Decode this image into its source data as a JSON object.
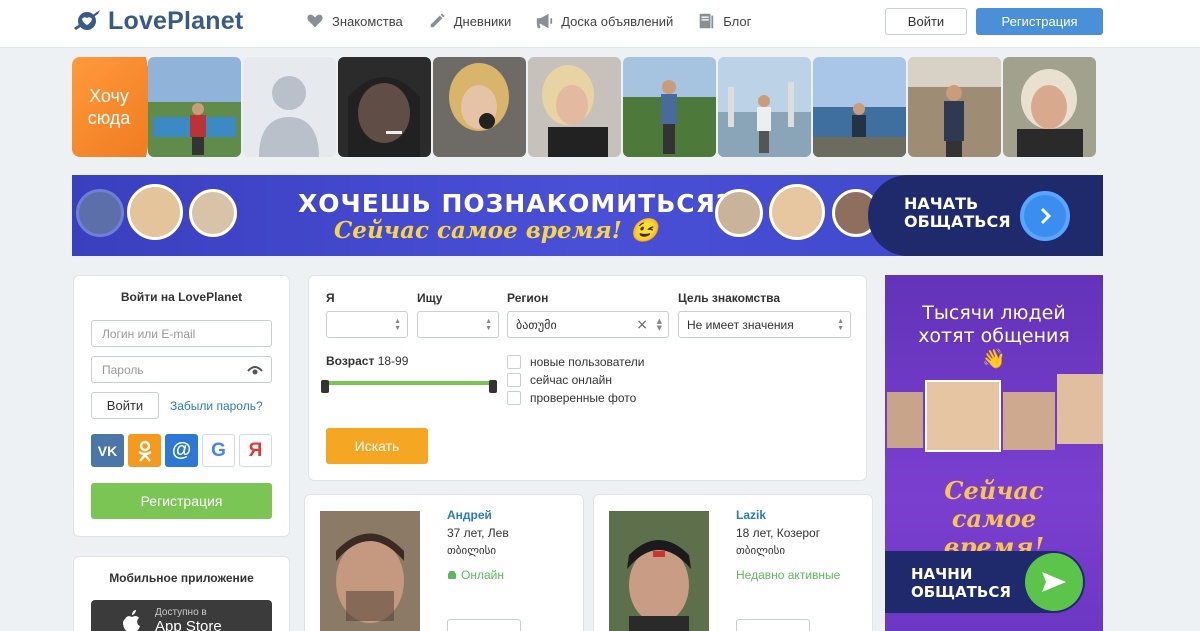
{
  "header": {
    "logo_text": "LovePlanet",
    "nav": [
      {
        "label": "Знакомства",
        "icon": "heart-icon"
      },
      {
        "label": "Дневники",
        "icon": "pencil-icon"
      },
      {
        "label": "Доска объявлений",
        "icon": "megaphone-icon"
      },
      {
        "label": "Блог",
        "icon": "book-icon"
      }
    ],
    "login_label": "Войти",
    "register_label": "Регистрация"
  },
  "strip": {
    "want_here": "Хочу сюда"
  },
  "banner": {
    "title": "ХОЧЕШЬ ПОЗНАКОМИТЬСЯ?",
    "subtitle": "Сейчас самое время! 😉",
    "cta": "НАЧАТЬ ОБЩАТЬСЯ"
  },
  "login": {
    "title": "Войти на LovePlanet",
    "login_placeholder": "Логин или E-mail",
    "password_placeholder": "Пароль",
    "enter_label": "Войти",
    "forgot_label": "Забыли пароль?",
    "socials": [
      {
        "name": "vk",
        "label": "VK",
        "color": "#4a76a8"
      },
      {
        "name": "ok",
        "label": "ОК",
        "color": "#f59a1d"
      },
      {
        "name": "mail",
        "label": "@",
        "color": "#2c78d4"
      },
      {
        "name": "google",
        "label": "G",
        "color": "#ffffff"
      },
      {
        "name": "yandex",
        "label": "Я",
        "color": "#ffffff"
      }
    ],
    "register_label": "Регистрация"
  },
  "mobile": {
    "title": "Мобильное приложение",
    "store_small": "Доступно в",
    "store_big": "App Store"
  },
  "search": {
    "i_label": "Я",
    "seek_label": "Ищу",
    "region_label": "Регион",
    "goal_label": "Цель знакомства",
    "i_value": "",
    "seek_value": "",
    "region_value": "ბათუმი",
    "goal_value": "Не имеет значения",
    "age_label": "Возраст",
    "age_value": "18-99",
    "age_min": 18,
    "age_max": 99,
    "checks": [
      "новые пользователи",
      "сейчас онлайн",
      "проверенные фото"
    ],
    "search_label": "Искать"
  },
  "profiles": [
    {
      "name": "Андрей",
      "info": "37 лет, Лев",
      "city": "თბილისი",
      "status": "Онлайн"
    },
    {
      "name": "Lazik",
      "info": "18 лет, Козерог",
      "city": "თბილისი",
      "status": "Недавно активные"
    }
  ],
  "ad": {
    "title": "Тысячи людей хотят общения 👋",
    "middle": "Сейчас самое время!",
    "cta": "НАЧНИ ОБЩАТЬСЯ"
  },
  "colors": {
    "brand": "#3a5a86",
    "primary": "#4a90d9",
    "green": "#7ac554",
    "orange": "#f5a623"
  }
}
